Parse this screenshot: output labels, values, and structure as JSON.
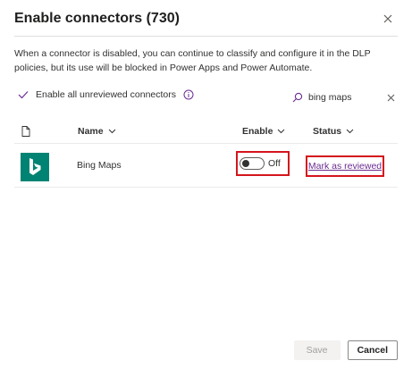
{
  "dialog": {
    "title": "Enable connectors (730)",
    "description": "When a connector is disabled, you can continue to classify and configure it in the DLP policies, but its use will be blocked in Power Apps and Power Automate."
  },
  "toolbar": {
    "enable_all_label": "Enable all unreviewed connectors",
    "search_value": "bing maps"
  },
  "table": {
    "columns": {
      "name": "Name",
      "enable": "Enable",
      "status": "Status"
    },
    "rows": [
      {
        "name": "Bing Maps",
        "enable_label": "Off",
        "enabled": false,
        "status_action": "Mark as reviewed"
      }
    ]
  },
  "footer": {
    "save_label": "Save",
    "cancel_label": "Cancel"
  },
  "colors": {
    "accent": "#6b2c91",
    "highlight": "#d4151c",
    "logo_bg": "#008373"
  },
  "icons": {
    "close": "close-icon",
    "check": "checkmark-icon",
    "info": "info-icon",
    "search": "search-icon",
    "clear": "clear-icon",
    "file": "file-icon",
    "chevron": "chevron-down-icon",
    "logo": "bing-logo-icon"
  }
}
